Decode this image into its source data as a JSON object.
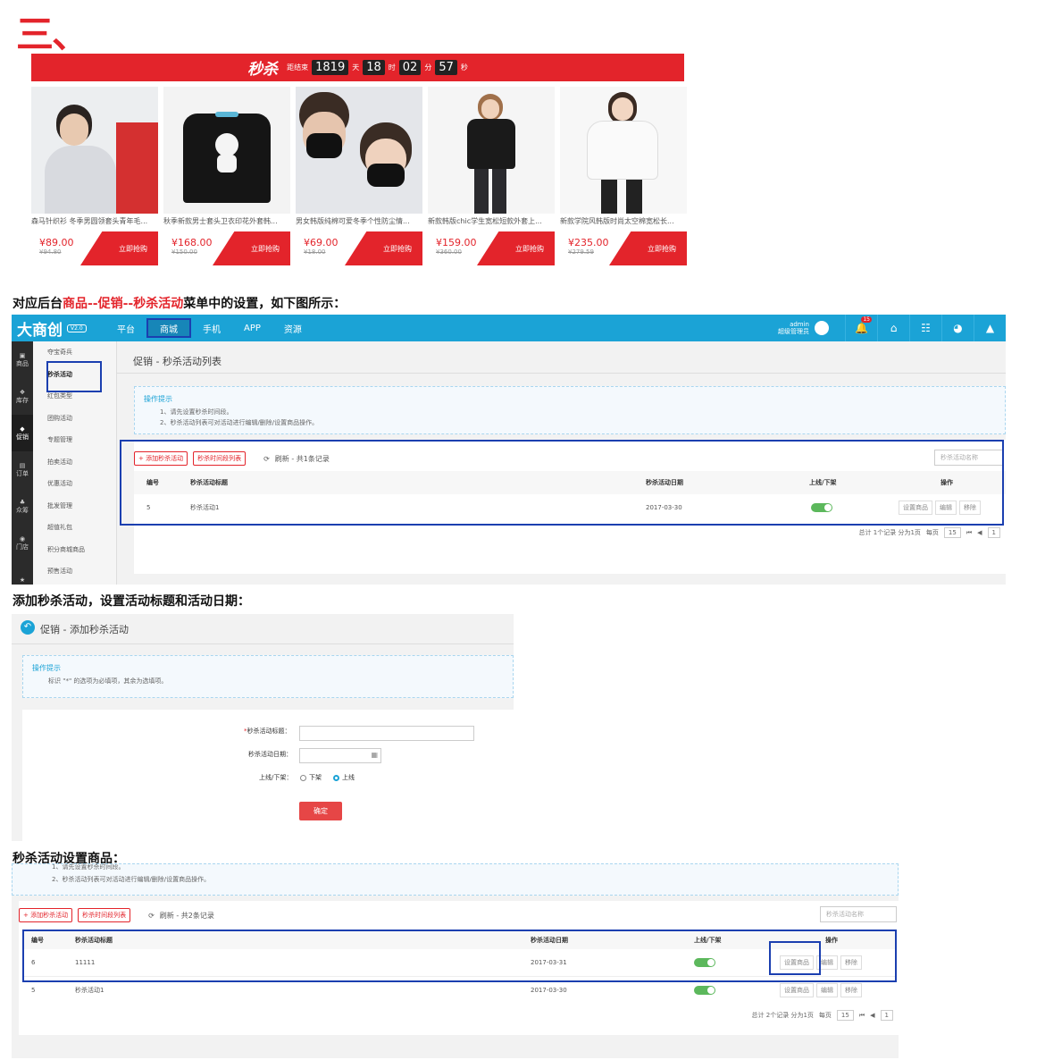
{
  "heading": "三、",
  "flash_sale": {
    "logo": "秒杀",
    "countdown_prefix": "距结束",
    "days": "1819",
    "day_unit": "天",
    "hours": "18",
    "hour_unit": "时",
    "minutes": "02",
    "minute_unit": "分",
    "seconds": "57",
    "second_unit": "秒",
    "products": [
      {
        "name": "森马针织衫 冬季男圆领套头青年毛...",
        "price": "¥89.00",
        "old_price": "¥94.80",
        "buy": "立即抢购"
      },
      {
        "name": "秋季新款男士套头卫衣印花外套韩...",
        "price": "¥168.00",
        "old_price": "¥150.00",
        "buy": "立即抢购"
      },
      {
        "name": "男女韩版纯棉可爱冬季个性防尘情...",
        "price": "¥69.00",
        "old_price": "¥18.00",
        "buy": "立即抢购"
      },
      {
        "name": "新款韩版chic学生宽松短款外套上...",
        "price": "¥159.00",
        "old_price": "¥360.00",
        "buy": "立即抢购"
      },
      {
        "name": "新款学院风韩版时尚太空棉宽松长...",
        "price": "¥235.00",
        "old_price": "¥279.59",
        "buy": "立即抢购"
      }
    ]
  },
  "caption1": {
    "pre": "对应后台",
    "red": "商品--促销--秒杀活动",
    "post": "菜单中的设置，如下图所示："
  },
  "caption2": "添加秒杀活动，设置活动标题和活动日期：",
  "caption3": "秒杀活动设置商品：",
  "admin": {
    "logo": "大商创",
    "version": "V2.0",
    "nav": [
      "平台",
      "商城",
      "手机",
      "APP",
      "资源"
    ],
    "user_name": "admin",
    "user_role": "超级管理员",
    "notif_count": "15",
    "sidebar": [
      "商品",
      "库存",
      "促销",
      "订单",
      "众筹",
      "门店"
    ],
    "submenu": [
      "夺宝奇兵",
      "秒杀活动",
      "红包类型",
      "团购活动",
      "专题管理",
      "拍卖活动",
      "优惠活动",
      "批发管理",
      "超值礼包",
      "积分商城商品",
      "预售活动"
    ],
    "page_title": "促销 - 秒杀活动列表",
    "tips_title": "操作提示",
    "tips": [
      "1、请先设置秒杀时间段。",
      "2、秒杀活动列表可对活动进行编辑/删除/设置商品操作。"
    ],
    "add_btn": "+ 添加秒杀活动",
    "time_btn": "秒杀时间段列表",
    "refresh": "刷新 - 共1条记录",
    "search_placeholder": "秒杀活动名称",
    "columns": [
      "编号",
      "秒杀活动标题",
      "秒杀活动日期",
      "上线/下架",
      "操作"
    ],
    "rows": [
      {
        "id": "5",
        "title": "秒杀活动1",
        "date": "2017-03-30"
      }
    ],
    "ops": [
      "设置商品",
      "编辑",
      "移除"
    ],
    "pager_total": "总计 1个记录 分为1页",
    "per_page_label": "每页",
    "per_page": "15",
    "page": "1"
  },
  "add_form": {
    "title": "促销 - 添加秒杀活动",
    "tips_title": "操作提示",
    "tip": "标识 \"*\" 的选项为必填项，其余为选填项。",
    "label_title": "秒杀活动标题：",
    "label_date": "秒杀活动日期：",
    "label_status": "上线/下架：",
    "opt_off": "下架",
    "opt_on": "上线",
    "confirm": "确定"
  },
  "list2": {
    "tips": [
      "1、请先设置秒杀时间段。",
      "2、秒杀活动列表可对活动进行编辑/删除/设置商品操作。"
    ],
    "add_btn": "+ 添加秒杀活动",
    "time_btn": "秒杀时间段列表",
    "refresh": "刷新 - 共2条记录",
    "search_placeholder": "秒杀活动名称",
    "columns": [
      "编号",
      "秒杀活动标题",
      "秒杀活动日期",
      "上线/下架",
      "操作"
    ],
    "rows": [
      {
        "id": "6",
        "title": "11111",
        "date": "2017-03-31"
      },
      {
        "id": "5",
        "title": "秒杀活动1",
        "date": "2017-03-30"
      }
    ],
    "ops": [
      "设置商品",
      "编辑",
      "移除"
    ],
    "pager_total": "总计 2个记录 分为1页",
    "per_page_label": "每页",
    "per_page": "15",
    "page": "1"
  },
  "colors": {
    "red": "#e3242b",
    "blue": "#1ba3d6",
    "box": "#1b3fb0"
  }
}
